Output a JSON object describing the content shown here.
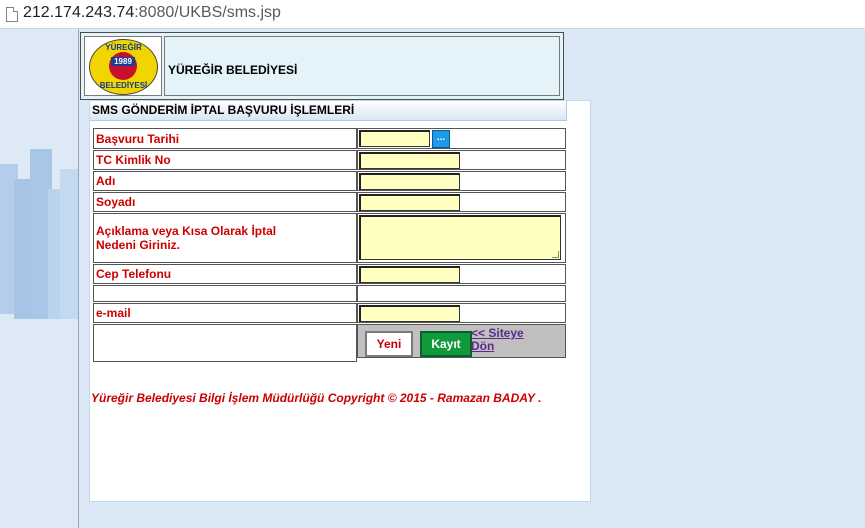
{
  "browser": {
    "url_host": "212.174.243.74",
    "url_rest": ":8080/UKBS/sms.jsp"
  },
  "header": {
    "logo_top_text": "YÜREĞİR",
    "logo_year": "1989",
    "logo_bottom_text": "BELEDİYESİ",
    "title": "YÜREĞİR BELEDİYESİ"
  },
  "form": {
    "heading": "SMS GÖNDERİM İPTAL BAŞVURU İŞLEMLERİ",
    "fields": {
      "basvuru_tarihi": "Başvuru Tarihi",
      "tc_kimlik": "TC Kimlik No",
      "adi": "Adı",
      "soyadi": "Soyadı",
      "aciklama_line1": "Açıklama veya Kısa Olarak İptal",
      "aciklama_line2": "Nedeni Giriniz.",
      "cep_telefonu": "Cep Telefonu",
      "email": "e-mail"
    },
    "date_picker_label": "...",
    "buttons": {
      "yeni": "Yeni",
      "kayit": "Kayıt",
      "back_line1": "<< Siteye",
      "back_line2": "Dön"
    }
  },
  "footer": {
    "text": "Yüreğir Belediyesi Bilgi İşlem Müdürlüğü Copyright © 2015 - Ramazan BADAY ."
  },
  "colors": {
    "label_red": "#cc0000",
    "input_yellow": "#ffffc0",
    "kayit_green": "#109a3c",
    "background_blue": "#dbe9f6"
  }
}
